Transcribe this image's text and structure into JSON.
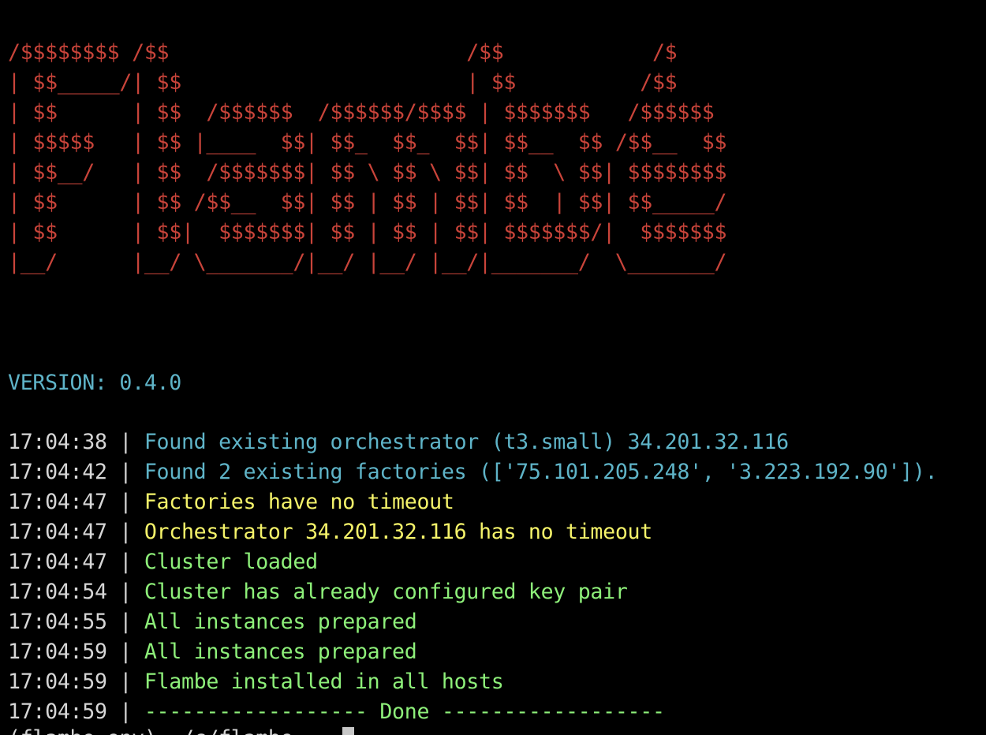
{
  "banner": {
    "color": "#c9443a",
    "lines": [
      "/$$$$$$$$ /$$                        /$$            /$",
      "| $$_____/| $$                       | $$          /$$",
      "| $$      | $$  /$$$$$$  /$$$$$$/$$$$ | $$$$$$$   /$$$$$$",
      "| $$$$$   | $$ |____  $$| $$_  $$_  $$| $$__  $$ /$$__  $$",
      "| $$__/   | $$  /$$$$$$$| $$ \\ $$ \\ $$| $$  \\ $$| $$$$$$$$",
      "| $$      | $$ /$$__  $$| $$ | $$ | $$| $$  | $$| $$_____/",
      "| $$      | $$|  $$$$$$$| $$ | $$ | $$| $$$$$$$/|  $$$$$$$",
      "|__/      |__/ \\_______/|__/ |__/ |__/|_______/  \\_______/"
    ]
  },
  "version": {
    "text": "VERSION: 0.4.0",
    "color": "#5fb4c8"
  },
  "colors": {
    "timestamp": "#d6d6d6",
    "cyan": "#5fb4c8",
    "yellow": "#f5f36a",
    "green": "#8ef07a"
  },
  "log": [
    {
      "time": "17:04:38",
      "sep": " | ",
      "message": "Found existing orchestrator (t3.small) 34.201.32.116",
      "color": "#5fb4c8"
    },
    {
      "time": "17:04:42",
      "sep": " | ",
      "message": "Found 2 existing factories (['75.101.205.248', '3.223.192.90']).",
      "color": "#5fb4c8"
    },
    {
      "time": "17:04:47",
      "sep": " | ",
      "message": "Factories have no timeout",
      "color": "#f5f36a"
    },
    {
      "time": "17:04:47",
      "sep": " | ",
      "message": "Orchestrator 34.201.32.116 has no timeout",
      "color": "#f5f36a"
    },
    {
      "time": "17:04:47",
      "sep": " | ",
      "message": "Cluster loaded",
      "color": "#8ef07a"
    },
    {
      "time": "17:04:54",
      "sep": " | ",
      "message": "Cluster has already configured key pair",
      "color": "#8ef07a"
    },
    {
      "time": "17:04:55",
      "sep": " | ",
      "message": "All instances prepared",
      "color": "#8ef07a"
    },
    {
      "time": "17:04:59",
      "sep": " | ",
      "message": "All instances prepared",
      "color": "#8ef07a"
    },
    {
      "time": "17:04:59",
      "sep": " | ",
      "message": "Flambe installed in all hosts",
      "color": "#8ef07a"
    },
    {
      "time": "17:04:59",
      "sep": " | ",
      "message": "------------------ Done ------------------",
      "color": "#8ef07a"
    }
  ],
  "prompt": {
    "text": "(flambe-env) ~/c/flambe    ",
    "cursor_icon": "block-cursor-icon"
  }
}
